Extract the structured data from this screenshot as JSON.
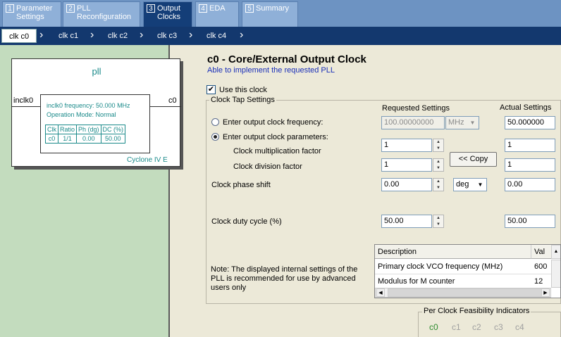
{
  "top_tabs": [
    {
      "num": "1",
      "label1": "Parameter",
      "label2": "Settings"
    },
    {
      "num": "2",
      "label1": "PLL",
      "label2": "Reconfiguration"
    },
    {
      "num": "3",
      "label1": "Output",
      "label2": "Clocks"
    },
    {
      "num": "4",
      "label1": "EDA",
      "label2": ""
    },
    {
      "num": "5",
      "label1": "Summary",
      "label2": ""
    }
  ],
  "clock_tabs": [
    "clk c0",
    "clk c1",
    "clk c2",
    "clk c3",
    "clk c4"
  ],
  "pll_diagram": {
    "title": "pll",
    "input": "inclk0",
    "output": "c0",
    "freq": "inclk0 frequency: 50.000 MHz",
    "mode": "Operation Mode: Normal",
    "table_headers": [
      "Clk",
      "Ratio",
      "Ph (dg)",
      "DC (%)"
    ],
    "table_row": [
      "c0",
      "1/1",
      "0.00",
      "50.00"
    ],
    "device": "Cyclone IV E"
  },
  "header": {
    "title": "c0 - Core/External Output Clock",
    "subtitle": "Able to implement the requested PLL"
  },
  "use_clock_label": "Use this clock",
  "clock_tap_label": "Clock Tap Settings",
  "requested_header": "Requested Settings",
  "actual_header": "Actual Settings",
  "radio_freq_label": "Enter output clock frequency:",
  "radio_params_label": "Enter output clock parameters:",
  "mult_label": "Clock multiplication factor",
  "div_label": "Clock division factor",
  "phase_label": "Clock phase shift",
  "duty_label": "Clock duty cycle (%)",
  "values": {
    "req_freq": "100.00000000",
    "freq_unit": "MHz",
    "act_freq": "50.000000",
    "req_mult": "1",
    "act_mult": "1",
    "req_div": "1",
    "act_div": "1",
    "req_phase": "0.00",
    "phase_unit": "deg",
    "act_phase": "0.00",
    "req_duty": "50.00",
    "act_duty": "50.00"
  },
  "copy_button": "<< Copy",
  "note": [
    "Note: The displayed internal settings of the",
    "PLL is recommended for use by advanced",
    "users only"
  ],
  "desc_table": {
    "headers": [
      "Description",
      "Val"
    ],
    "rows": [
      [
        "Primary clock VCO frequency (MHz)",
        "600"
      ],
      [
        "Modulus for M counter",
        "12"
      ]
    ]
  },
  "feasibility": {
    "title": "Per Clock Feasibility Indicators",
    "items": [
      "c0",
      "c1",
      "c2",
      "c3",
      "c4"
    ],
    "colors": {
      "active": "#2e8b2e",
      "inactive": "#a0a0a0"
    }
  }
}
